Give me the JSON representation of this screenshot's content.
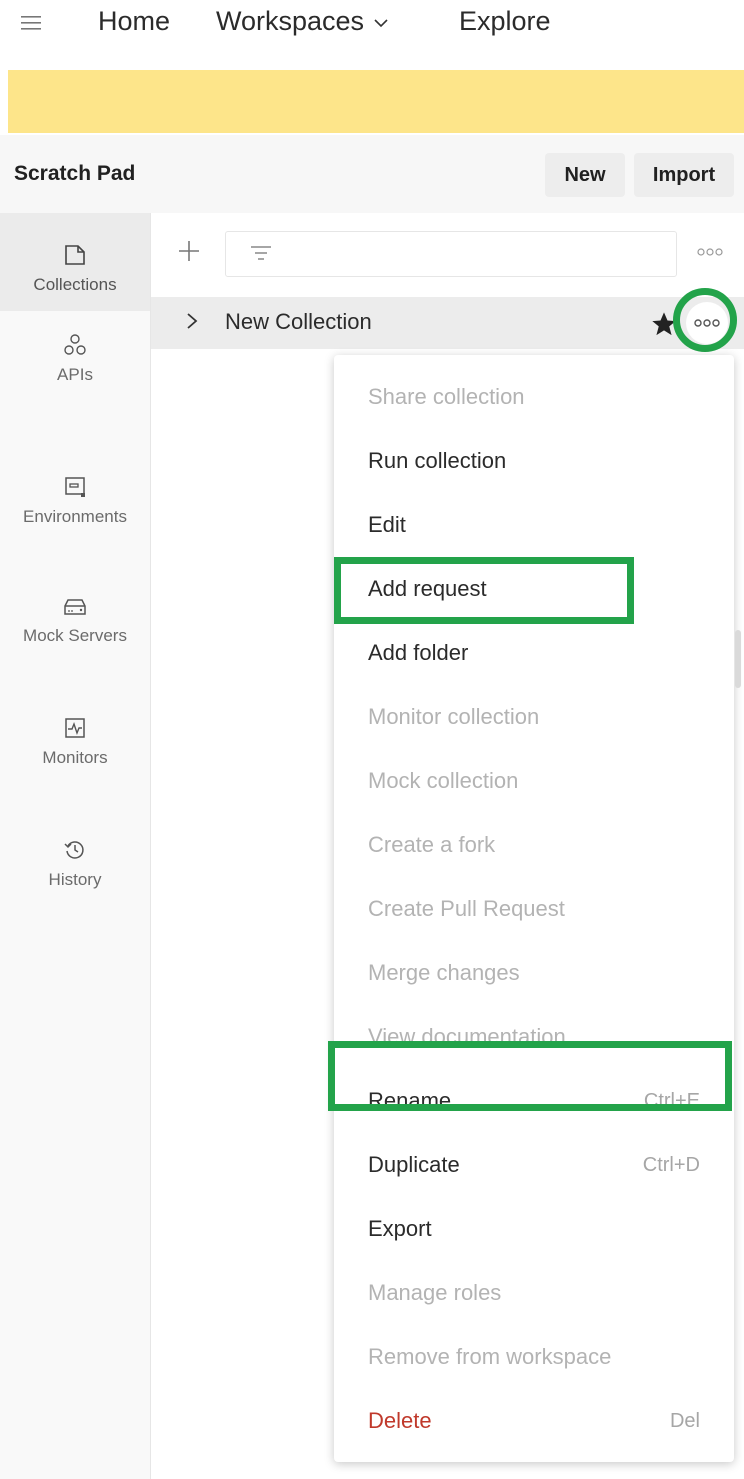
{
  "topnav": {
    "home": "Home",
    "workspaces": "Workspaces",
    "explore": "Explore"
  },
  "workspace": {
    "title": "Scratch Pad",
    "new_label": "New",
    "import_label": "Import"
  },
  "rail": {
    "items": [
      {
        "label": "Collections",
        "icon": "collections-icon"
      },
      {
        "label": "APIs",
        "icon": "apis-icon"
      },
      {
        "label": "Environments",
        "icon": "environments-icon"
      },
      {
        "label": "Mock Servers",
        "icon": "mock-servers-icon"
      },
      {
        "label": "Monitors",
        "icon": "monitors-icon"
      },
      {
        "label": "History",
        "icon": "history-icon"
      }
    ]
  },
  "collection": {
    "name": "New Collection"
  },
  "context_menu": {
    "items": [
      {
        "label": "Share collection",
        "disabled": true,
        "shortcut": ""
      },
      {
        "label": "Run collection",
        "disabled": false,
        "shortcut": ""
      },
      {
        "label": "Edit",
        "disabled": false,
        "shortcut": ""
      },
      {
        "label": "Add request",
        "disabled": false,
        "shortcut": "",
        "highlighted": true
      },
      {
        "label": "Add folder",
        "disabled": false,
        "shortcut": ""
      },
      {
        "label": "Monitor collection",
        "disabled": true,
        "shortcut": ""
      },
      {
        "label": "Mock collection",
        "disabled": true,
        "shortcut": ""
      },
      {
        "label": "Create a fork",
        "disabled": true,
        "shortcut": ""
      },
      {
        "label": "Create Pull Request",
        "disabled": true,
        "shortcut": ""
      },
      {
        "label": "Merge changes",
        "disabled": true,
        "shortcut": ""
      },
      {
        "label": "View documentation",
        "disabled": true,
        "shortcut": ""
      },
      {
        "label": "Rename",
        "disabled": false,
        "shortcut": "Ctrl+E",
        "highlighted": true
      },
      {
        "label": "Duplicate",
        "disabled": false,
        "shortcut": "Ctrl+D"
      },
      {
        "label": "Export",
        "disabled": false,
        "shortcut": ""
      },
      {
        "label": "Manage roles",
        "disabled": true,
        "shortcut": ""
      },
      {
        "label": "Remove from workspace",
        "disabled": true,
        "shortcut": ""
      },
      {
        "label": "Delete",
        "disabled": false,
        "shortcut": "Del",
        "danger": true
      }
    ]
  },
  "colors": {
    "banner": "#fde58a",
    "highlight": "#23a34a",
    "danger": "#c0392b"
  }
}
